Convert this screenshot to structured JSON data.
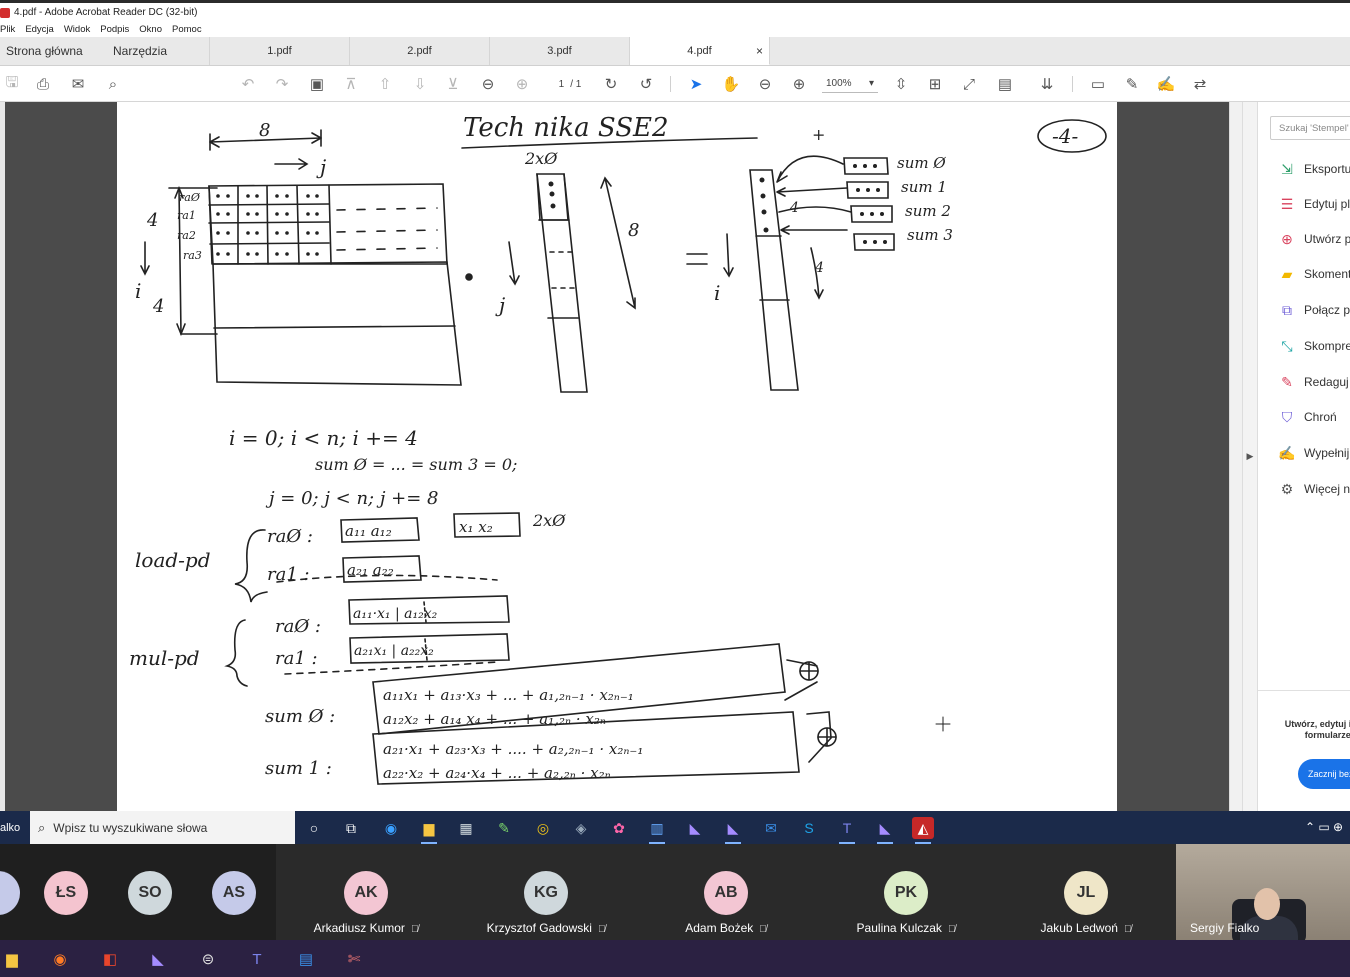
{
  "window": {
    "title": "4.pdf - Adobe Acrobat Reader DC (32-bit)"
  },
  "menu": [
    "Plik",
    "Edycja",
    "Widok",
    "Podpis",
    "Okno",
    "Pomoc"
  ],
  "nav": {
    "home": "Strona główna",
    "tools": "Narzędzia"
  },
  "tabs": [
    {
      "label": "1.pdf"
    },
    {
      "label": "2.pdf"
    },
    {
      "label": "3.pdf"
    },
    {
      "label": "4.pdf",
      "active": true,
      "close": "×"
    }
  ],
  "toolbar": {
    "page_current": "1",
    "page_total": "/ 1",
    "zoom": "100%"
  },
  "document": {
    "title": "Tech nika  SSE2",
    "page_number": "-4-",
    "labels": {
      "n8": "8",
      "j": "j",
      "i": "i",
      "n4": "4",
      "n4b": "4",
      "col": "2xØ",
      "n8b": "8",
      "eq": "=",
      "dot": "•",
      "jj": "j",
      "ii": "i",
      "plus": "+",
      "n4c": "4",
      "n4d": "4",
      "ra0": "raØ",
      "ra1": "ra1",
      "ra2": "ra2",
      "ra3": "ra3",
      "sum0": "sum Ø",
      "sum1": "sum 1",
      "sum2": "sum 2",
      "sum3": "sum 3"
    },
    "code": {
      "loop_i": "i = 0;  i < n;  i += 4",
      "init": "sum Ø = ... = sum 3 = 0;",
      "loop_j": "j = 0;  j < n;  j += 8",
      "load_pd": "load-pd",
      "ra0": "raØ :",
      "ra0_val": "a₁₁  a₁₂",
      "x_val": "x₁  x₂",
      "x_reg": "2xØ",
      "ra1": "ra1 :",
      "ra1_val": "a₂₁  a₂₂",
      "mul_pd": "mul-pd",
      "mra0": "raØ :",
      "mra0_val": "a₁₁·x₁ | a₁₂x₂",
      "mra1": "ra1 :",
      "mra1_val": "a₂₁x₁ | a₂₂x₂",
      "sum0": "sum Ø :",
      "sum0_l1": "a₁₁x₁  + a₁₃·x₃ + ... + a₁,₂ₙ₋₁ · x₂ₙ₋₁",
      "sum0_l2": "a₁₂x₂  + a₁₄ x₄ + ... + a₁,₂ₙ · x₂ₙ",
      "sum1": "sum 1 :",
      "sum1_l1": "a₂₁·x₁ + a₂₃·x₃ + .... + a₂,₂ₙ₋₁ · x₂ₙ₋₁",
      "sum1_l2": "a₂₂·x₂ + a₂₄·x₄ + ... + a₂,₂ₙ · x₂ₙ",
      "oplus": "⊕"
    }
  },
  "right_pane": {
    "search_placeholder": "Szukaj 'Stempel'",
    "tools": [
      {
        "label": "Eksportuj PDF",
        "icon": "export-pdf-icon",
        "color": "#2e9e6b"
      },
      {
        "label": "Edytuj plik PDF",
        "icon": "edit-pdf-icon",
        "color": "#d9435e"
      },
      {
        "label": "Utwórz plik PDF",
        "icon": "create-pdf-icon",
        "color": "#d9435e"
      },
      {
        "label": "Skomentuj",
        "icon": "comment-icon",
        "color": "#f2b800"
      },
      {
        "label": "Połącz pliki",
        "icon": "combine-icon",
        "color": "#6b5bd6"
      },
      {
        "label": "Skompresuj PDF",
        "icon": "compress-icon",
        "color": "#1aa3a3"
      },
      {
        "label": "Redaguj",
        "icon": "redact-icon",
        "color": "#d9435e"
      },
      {
        "label": "Chroń",
        "icon": "protect-icon",
        "color": "#6b5bd6"
      },
      {
        "label": "Wypełnij i podpisz",
        "icon": "fill-sign-icon",
        "color": "#7a5bd6"
      },
      {
        "label": "Więcej narzędzi",
        "icon": "more-tools-icon",
        "color": "#555555"
      }
    ],
    "promo_text": "Utwórz, edytuj i podpisuj formularze PDF",
    "promo_button": "Zacznij bezpłatny okres próbny"
  },
  "taskbar": {
    "user": "alko",
    "search_placeholder": "Wpisz tu wyszukiwane słowa"
  },
  "meeting": {
    "avatars": [
      {
        "initials": "ŁS",
        "color": "#f4c4cf"
      },
      {
        "initials": "SO",
        "color": "#cfd8dc"
      },
      {
        "initials": "AS",
        "color": "#c5cae9"
      }
    ],
    "participants": [
      {
        "initials": "AK",
        "name": "Arkadiusz Kumor",
        "color": "#f3c6d3"
      },
      {
        "initials": "KG",
        "name": "Krzysztof Gadowski",
        "color": "#cfd8dc"
      },
      {
        "initials": "AB",
        "name": "Adam Bożek",
        "color": "#f3c6d3"
      },
      {
        "initials": "PK",
        "name": "Paulina Kulczak",
        "color": "#dcedc8"
      },
      {
        "initials": "JL",
        "name": "Jakub Ledwoń",
        "color": "#efe6c8"
      }
    ],
    "presenter": "Sergiy Fialko"
  }
}
